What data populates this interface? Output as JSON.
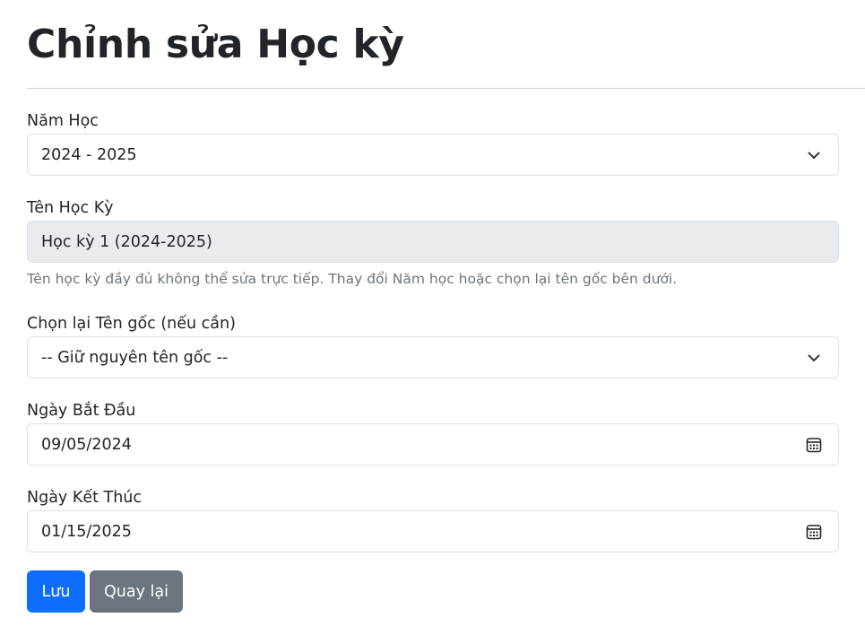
{
  "page_title": "Chỉnh sửa Học kỳ",
  "fields": {
    "nam_hoc": {
      "label": "Năm Học",
      "value": "2024 - 2025",
      "icon": "chevron-down-icon"
    },
    "ten_hoc_ky": {
      "label": "Tên Học Kỳ",
      "value": "Học kỳ 1 (2024-2025)",
      "help": "Tên học kỳ đầy đủ không thể sửa trực tiếp. Thay đổi Năm học hoặc chọn lại tên gốc bên dưới."
    },
    "ten_goc": {
      "label": "Chọn lại Tên gốc (nếu cần)",
      "value": "-- Giữ nguyên tên gốc --",
      "icon": "chevron-down-icon"
    },
    "ngay_bat_dau": {
      "label": "Ngày Bắt Đầu",
      "value": "09/05/2024",
      "icon": "calendar-icon"
    },
    "ngay_ket_thuc": {
      "label": "Ngày Kết Thúc",
      "value": "01/15/2025",
      "icon": "calendar-icon"
    }
  },
  "buttons": {
    "save_label": "Lưu",
    "back_label": "Quay lại"
  },
  "colors": {
    "primary": "#0d6efd",
    "secondary": "#6c757d",
    "readonly_bg": "#e9ecef",
    "border": "#dee2e6",
    "muted_text": "#6c757d"
  }
}
